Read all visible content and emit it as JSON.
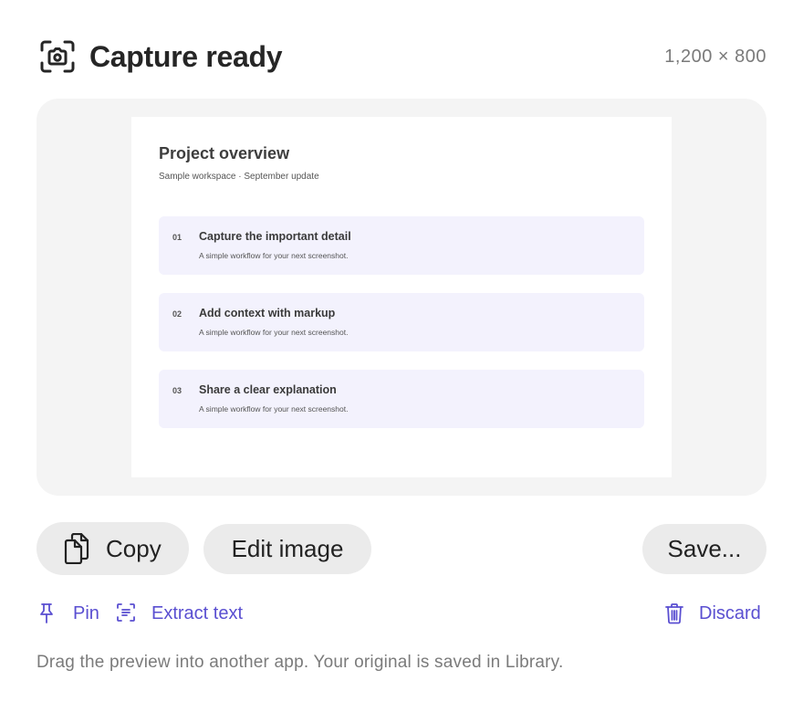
{
  "header": {
    "title": "Capture ready",
    "dimensions": "1,200 × 800",
    "icon": "camera-icon"
  },
  "preview": {
    "doc_title": "Project overview",
    "doc_subtitle": "Sample workspace · September update",
    "steps": [
      {
        "num": "01",
        "title": "Capture the important detail",
        "desc": "A simple workflow for your next screenshot."
      },
      {
        "num": "02",
        "title": "Add context with markup",
        "desc": "A simple workflow for your next screenshot."
      },
      {
        "num": "03",
        "title": "Share a clear explanation",
        "desc": "A simple workflow for your next screenshot."
      }
    ]
  },
  "actions": {
    "copy_label": "Copy",
    "copy_icon": "copy-icon",
    "edit_label": "Edit image",
    "save_label": "Save..."
  },
  "links": {
    "pin_label": "Pin",
    "pin_icon": "pin-icon",
    "extract_label": "Extract text",
    "extract_icon": "extract-text-icon",
    "discard_label": "Discard",
    "discard_icon": "trash-icon"
  },
  "footer": {
    "hint": "Drag the preview into another app. Your original is saved in Library."
  },
  "colors": {
    "accent": "#5a4fd1",
    "button_bg": "#ebebeb",
    "preview_bg": "#f4f4f4",
    "step_bg": "#f3f2fd"
  }
}
